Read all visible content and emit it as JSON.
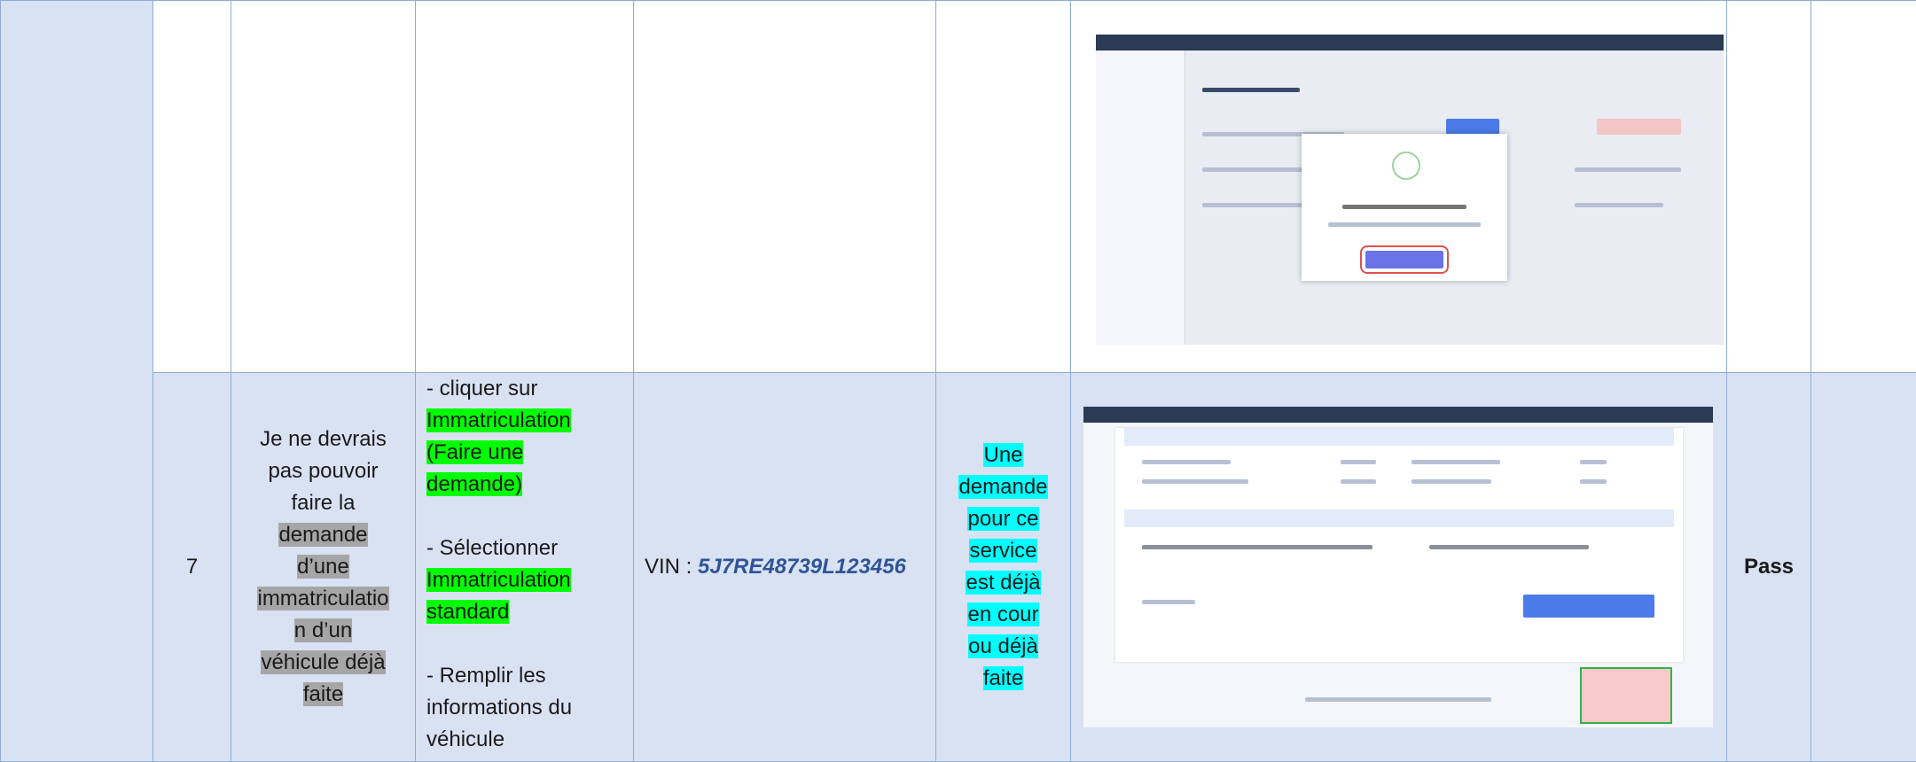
{
  "rows": [
    {
      "number": "",
      "description": "",
      "steps": [],
      "data_label": "",
      "data_value": "",
      "expected": "",
      "status": "",
      "screenshot": "modal-screenshot"
    },
    {
      "number": "7",
      "description": [
        "Je ne devrais",
        "pas pouvoir",
        "faire la",
        "demande",
        "d’une",
        "immatriculatio",
        "n d’un",
        "véhicule déjà",
        "faite"
      ],
      "steps": {
        "s1a": "- cliquer sur",
        "s1b": "Immatriculation",
        "s1c": "(Faire une",
        "s1d": "demande)",
        "s2a": "- Sélectionner",
        "s2b": "Immatriculation",
        "s2c": "standard",
        "s3a": "- Remplir les",
        "s3b": "informations du",
        "s3c": "véhicule"
      },
      "data_label": "VIN : ",
      "data_value": "5J7RE48739L123456",
      "expected": [
        "Une",
        "demande",
        "pour ce",
        "service",
        "est déjà",
        "en cour",
        "ou déjà",
        "faite"
      ],
      "status": "Pass",
      "screenshot": "form-screenshot"
    }
  ],
  "colors": {
    "border": "#8eaadb",
    "row_bg": "#d9e2f3",
    "pass": "#00b050",
    "vin": "#2f5597"
  }
}
